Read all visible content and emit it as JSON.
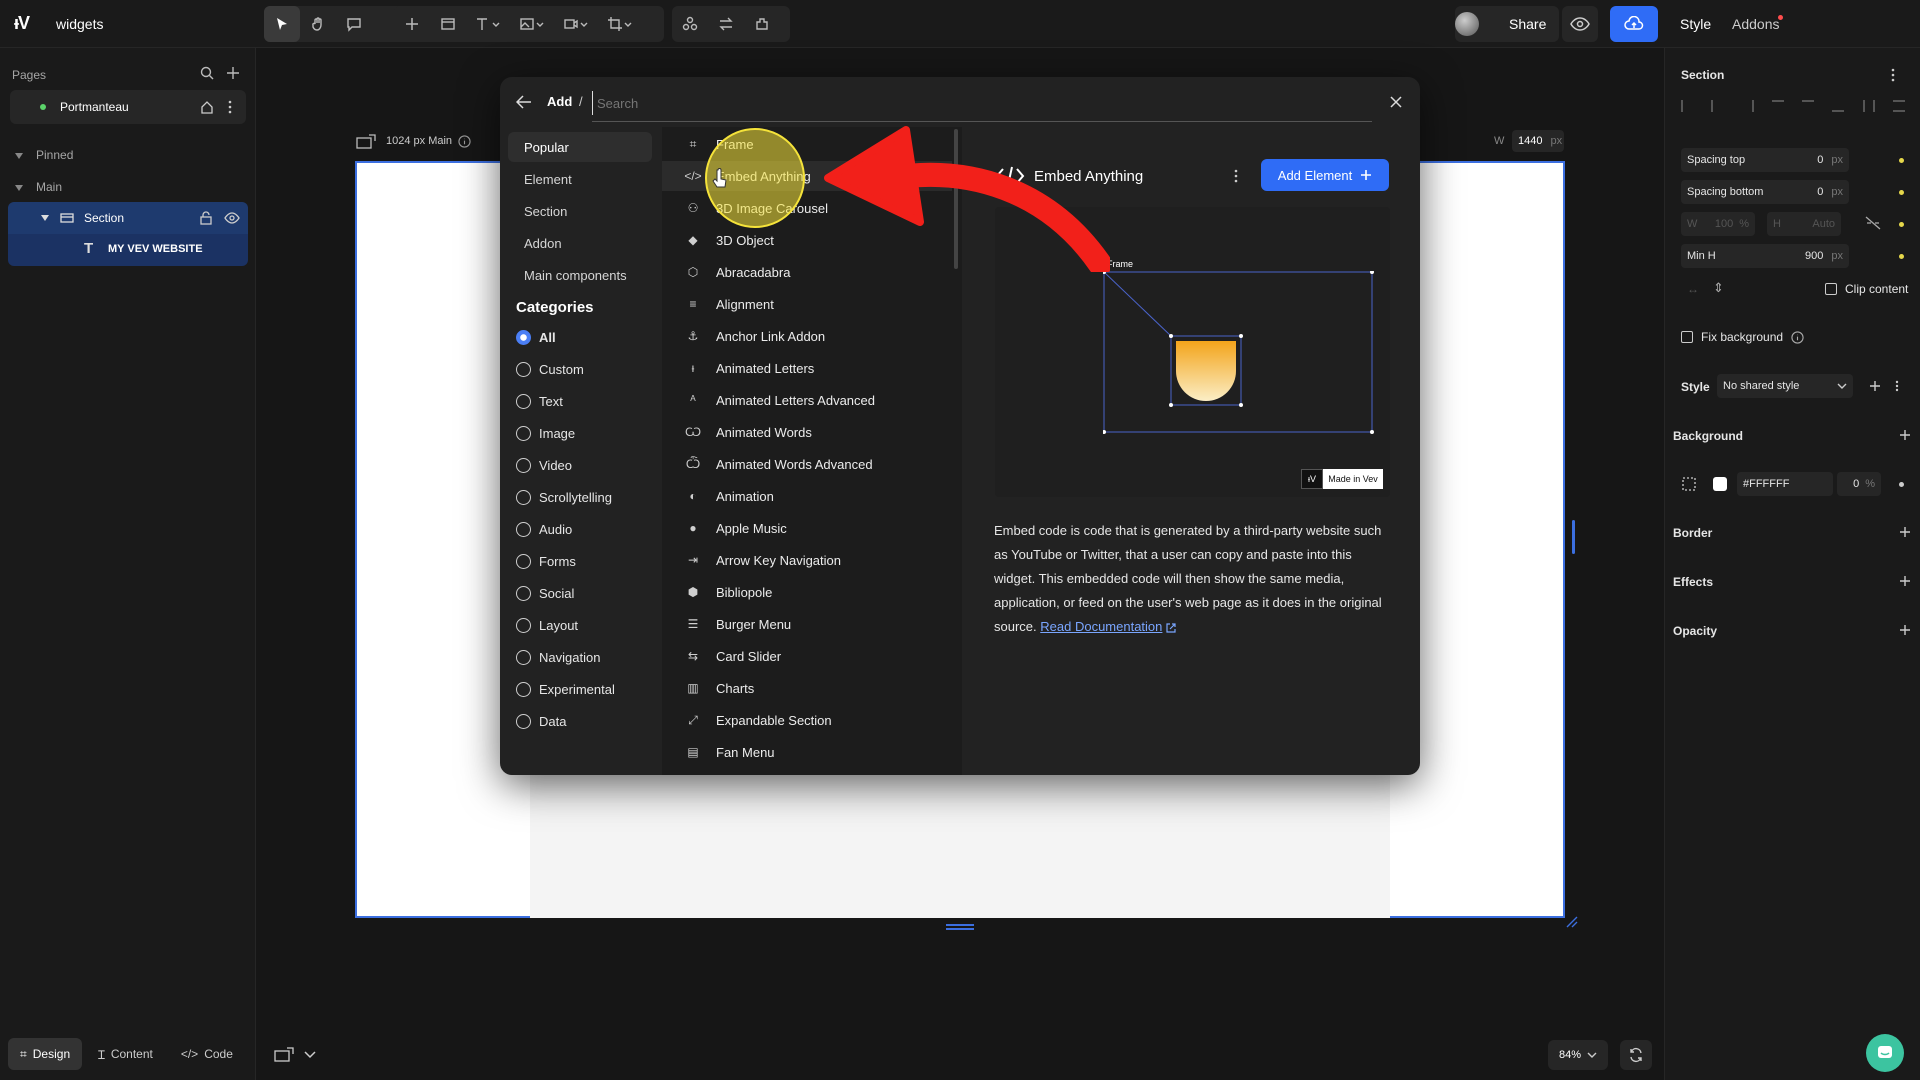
{
  "app": {
    "logo": "ᵻV",
    "project_name": "widgets"
  },
  "topbar": {
    "share_label": "Share",
    "right_tabs": {
      "style": "Style",
      "addons": "Addons"
    }
  },
  "left_panel": {
    "pages_label": "Pages",
    "page_name": "Portmanteau",
    "pinned_label": "Pinned",
    "main_label": "Main",
    "layers": [
      {
        "label": "Section"
      },
      {
        "label": "MY VEV WEBSITE"
      }
    ],
    "bottom_tabs": [
      "Design",
      "Content",
      "Code"
    ]
  },
  "canvas": {
    "breakpoint_label": "1024 px Main",
    "width_label": "W",
    "width_value": "1440",
    "width_unit": "px",
    "zoom": "84%"
  },
  "right_panel": {
    "section_title": "Section",
    "spacing_top_label": "Spacing top",
    "spacing_top_value": "0",
    "spacing_bottom_label": "Spacing bottom",
    "spacing_bottom_value": "0",
    "unit_px": "px",
    "w_label": "W",
    "w_value": "100",
    "w_unit": "%",
    "h_label": "H",
    "h_value": "Auto",
    "min_h_label": "Min H",
    "min_h_value": "900",
    "clip_content_label": "Clip content",
    "fix_background_label": "Fix background",
    "style_label": "Style",
    "style_value": "No shared style",
    "background_label": "Background",
    "bg_color": "#FFFFFF",
    "bg_opacity": "0",
    "bg_opacity_unit": "%",
    "border_label": "Border",
    "effects_label": "Effects",
    "opacity_label": "Opacity"
  },
  "modal": {
    "breadcrumb_add": "Add",
    "breadcrumb_sep": "/",
    "search_placeholder": "Search",
    "nav": [
      "Popular",
      "Element",
      "Section",
      "Addon",
      "Main components"
    ],
    "categories_title": "Categories",
    "categories": [
      "All",
      "Custom",
      "Text",
      "Image",
      "Video",
      "Scrollytelling",
      "Audio",
      "Forms",
      "Social",
      "Layout",
      "Navigation",
      "Experimental",
      "Data"
    ],
    "list": [
      {
        "label": "Frame",
        "icon": "frame-icon",
        "glyph": "⌗"
      },
      {
        "label": "Embed Anything",
        "icon": "code-icon",
        "glyph": "</>"
      },
      {
        "label": "3D Image Carousel",
        "icon": "carousel-icon",
        "glyph": "⚇"
      },
      {
        "label": "3D Object",
        "icon": "cube-icon",
        "glyph": "◆"
      },
      {
        "label": "Abracadabra",
        "icon": "cube-outline-icon",
        "glyph": "⬡"
      },
      {
        "label": "Alignment",
        "icon": "align-icon",
        "glyph": "≡"
      },
      {
        "label": "Anchor Link Addon",
        "icon": "anchor-icon",
        "glyph": "⚓"
      },
      {
        "label": "Animated Letters",
        "icon": "letters-icon",
        "glyph": "ᵻ"
      },
      {
        "label": "Animated Letters Advanced",
        "icon": "letters-adv-icon",
        "glyph": "ᴬ"
      },
      {
        "label": "Animated Words",
        "icon": "words-icon",
        "glyph": "Ѡ"
      },
      {
        "label": "Animated Words Advanced",
        "icon": "words-adv-icon",
        "glyph": "Ѽ"
      },
      {
        "label": "Animation",
        "icon": "toggle-icon",
        "glyph": "◐"
      },
      {
        "label": "Apple Music",
        "icon": "apple-icon",
        "glyph": "●"
      },
      {
        "label": "Arrow Key Navigation",
        "icon": "arrow-key-icon",
        "glyph": "⇥"
      },
      {
        "label": "Bibliopole",
        "icon": "box-icon",
        "glyph": "⬢"
      },
      {
        "label": "Burger Menu",
        "icon": "burger-icon",
        "glyph": "☰"
      },
      {
        "label": "Card Slider",
        "icon": "slider-icon",
        "glyph": "⇆"
      },
      {
        "label": "Charts",
        "icon": "chart-icon",
        "glyph": "▥"
      },
      {
        "label": "Expandable Section",
        "icon": "expand-icon",
        "glyph": "⤢"
      },
      {
        "label": "Fan Menu",
        "icon": "fan-icon",
        "glyph": "▤"
      }
    ],
    "detail": {
      "title": "Embed Anything",
      "add_button": "Add Element",
      "preview_frame_label": "Frame",
      "badge_logo": "ᵻV",
      "badge_text": "Made in Vev",
      "description": "Embed code is code that is generated by a third-party website such as YouTube or Twitter, that a user can copy and paste into this widget. This embedded code will then show the same media, application, or feed on the user's web page as it does in the original source.",
      "read_docs": "Read Documentation"
    }
  },
  "colors": {
    "accent": "#2f6cf6",
    "selection": "#1e3a6e",
    "annotation_red": "#f2201a",
    "highlight_yellow": "#f5e33a"
  }
}
